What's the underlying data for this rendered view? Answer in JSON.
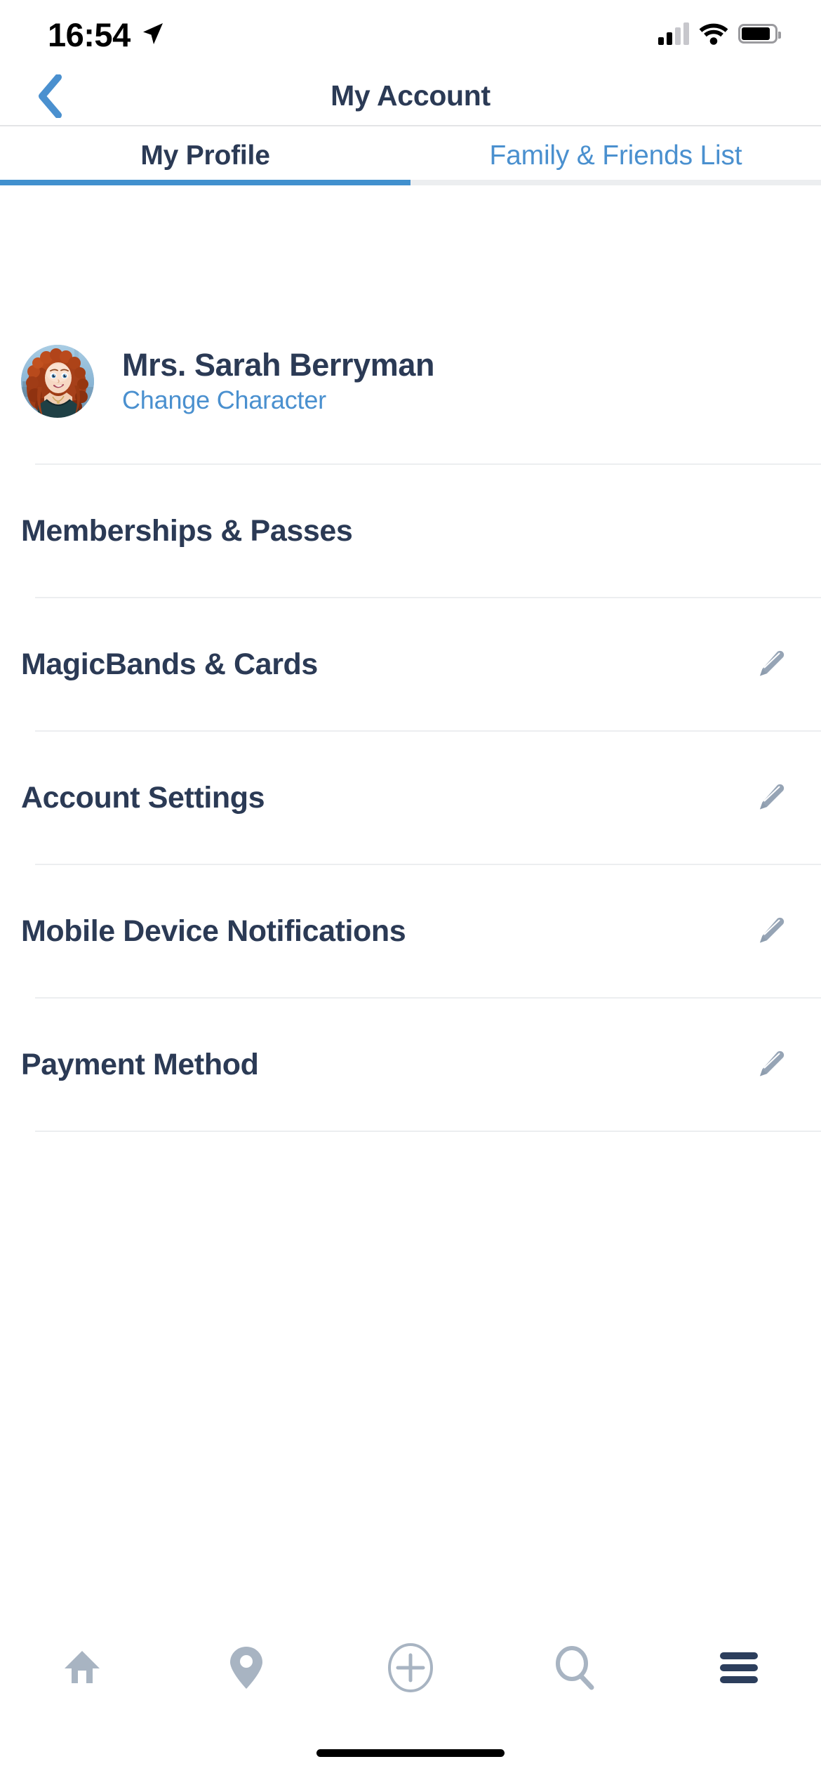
{
  "status_bar": {
    "time": "16:54",
    "location_icon": "location-arrow-icon",
    "signal_icon": "cellular-signal-icon",
    "wifi_icon": "wifi-icon",
    "battery_icon": "battery-icon"
  },
  "nav": {
    "back_icon": "chevron-left-icon",
    "title": "My Account"
  },
  "tabs": {
    "items": [
      {
        "label": "My Profile",
        "active": true
      },
      {
        "label": "Family & Friends List",
        "active": false
      }
    ],
    "active_color": "#4190CE",
    "inactive_color": "#ECEEF0"
  },
  "profile": {
    "avatar_name": "merida-character-avatar",
    "name": "Mrs. Sarah Berryman",
    "change_link": "Change Character"
  },
  "menu": {
    "items": [
      {
        "label": "Memberships & Passes",
        "edit": false,
        "edit_icon": ""
      },
      {
        "label": "MagicBands & Cards",
        "edit": true,
        "edit_icon": "pencil-icon"
      },
      {
        "label": "Account Settings",
        "edit": true,
        "edit_icon": "pencil-icon"
      },
      {
        "label": "Mobile Device Notifications",
        "edit": true,
        "edit_icon": "pencil-icon"
      },
      {
        "label": "Payment Method",
        "edit": true,
        "edit_icon": "pencil-icon"
      }
    ]
  },
  "tabbar": {
    "items": [
      {
        "name": "home-icon",
        "active": false
      },
      {
        "name": "map-pin-icon",
        "active": false
      },
      {
        "name": "plus-circle-icon",
        "active": false
      },
      {
        "name": "search-icon",
        "active": false
      },
      {
        "name": "hamburger-menu-icon",
        "active": true
      }
    ],
    "inactive_color": "#A8B4C2",
    "active_color": "#2C3E5C"
  },
  "colors": {
    "text_dark": "#2B3A55",
    "link_blue": "#4A90CF",
    "icon_gray": "#A8B4C2",
    "divider": "#ECEEF0"
  }
}
